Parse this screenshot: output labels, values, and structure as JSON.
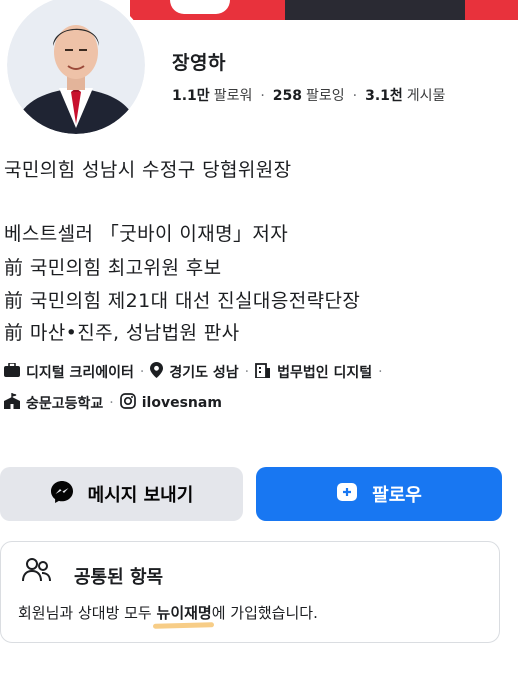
{
  "profile": {
    "name": "장영하",
    "stats": [
      {
        "value": "1.1만",
        "label": "팔로워"
      },
      {
        "value": "258",
        "label": "팔로잉"
      },
      {
        "value": "3.1천",
        "label": "게시물"
      }
    ]
  },
  "bio": [
    "국민의힘 성남시 수정구 당협위원장",
    "",
    "베스트셀러 「굿바이 이재명」저자",
    "前 국민의힘 최고위원 후보",
    "前 국민의힘 제21대 대선 진실대응전략단장",
    "前 마산•진주, 성남법원 판사"
  ],
  "details": {
    "category": "디지털 크리에이터",
    "location": "경기도 성남",
    "workplace": "법무법인 디지털",
    "school": "숭문고등학교",
    "instagram": "ilovesnam"
  },
  "actions": {
    "message_label": "메시지 보내기",
    "follow_label": "팔로우"
  },
  "common": {
    "title": "공통된 항목",
    "text_before": "회원님과 상대방 모두 ",
    "group_name": "뉴이재명",
    "text_after": "에 가입했습니다."
  },
  "colors": {
    "accent": "#1877f2",
    "cover_red": "#e8323c",
    "highlight": "#f6c87a"
  }
}
